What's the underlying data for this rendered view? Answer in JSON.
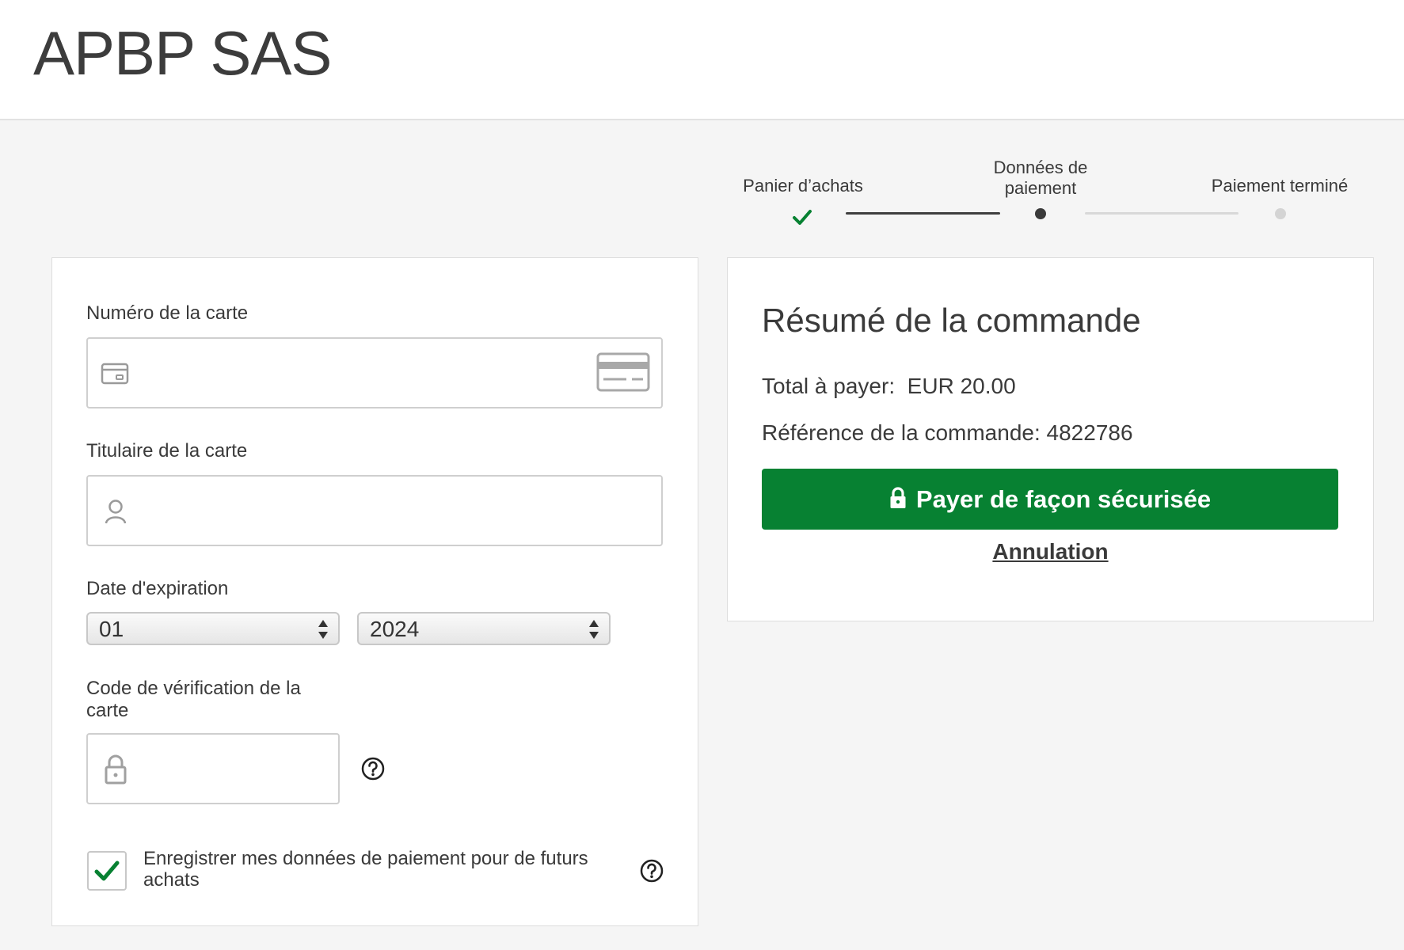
{
  "header": {
    "brand": "APBP SAS"
  },
  "stepper": {
    "steps": [
      {
        "label": "Panier d’achats",
        "state": "done"
      },
      {
        "label_line1": "Données de",
        "label_line2": "paiement",
        "state": "current"
      },
      {
        "label": "Paiement terminé",
        "state": "upcoming"
      }
    ]
  },
  "form": {
    "card_number": {
      "label": "Numéro de la carte",
      "value": "",
      "icon": "credit-card-icon",
      "brand_icon": "card-brand-icon"
    },
    "card_holder": {
      "label": "Titulaire de la carte",
      "value": "",
      "icon": "user-icon"
    },
    "expiry": {
      "label": "Date d'expiration",
      "month": "01",
      "year": "2024"
    },
    "cvc": {
      "label_line1": "Code de vérification de la",
      "label_line2": "carte",
      "value": "",
      "icon": "lock-icon"
    },
    "save": {
      "label_line1": "Enregistrer mes données de paiement pour de futurs",
      "label_line2": "achats",
      "checked": true
    }
  },
  "summary": {
    "title": "Résumé de la commande",
    "total_label": "Total à payer:",
    "total_value": "EUR 20.00",
    "reference_label": "Référence de la commande:",
    "reference_value": "4822786",
    "pay_button": "Payer de façon sécurisée",
    "cancel_link": "Annulation"
  },
  "colors": {
    "accent": "#078132",
    "background": "#f5f5f5",
    "text": "#3a3a3a"
  }
}
